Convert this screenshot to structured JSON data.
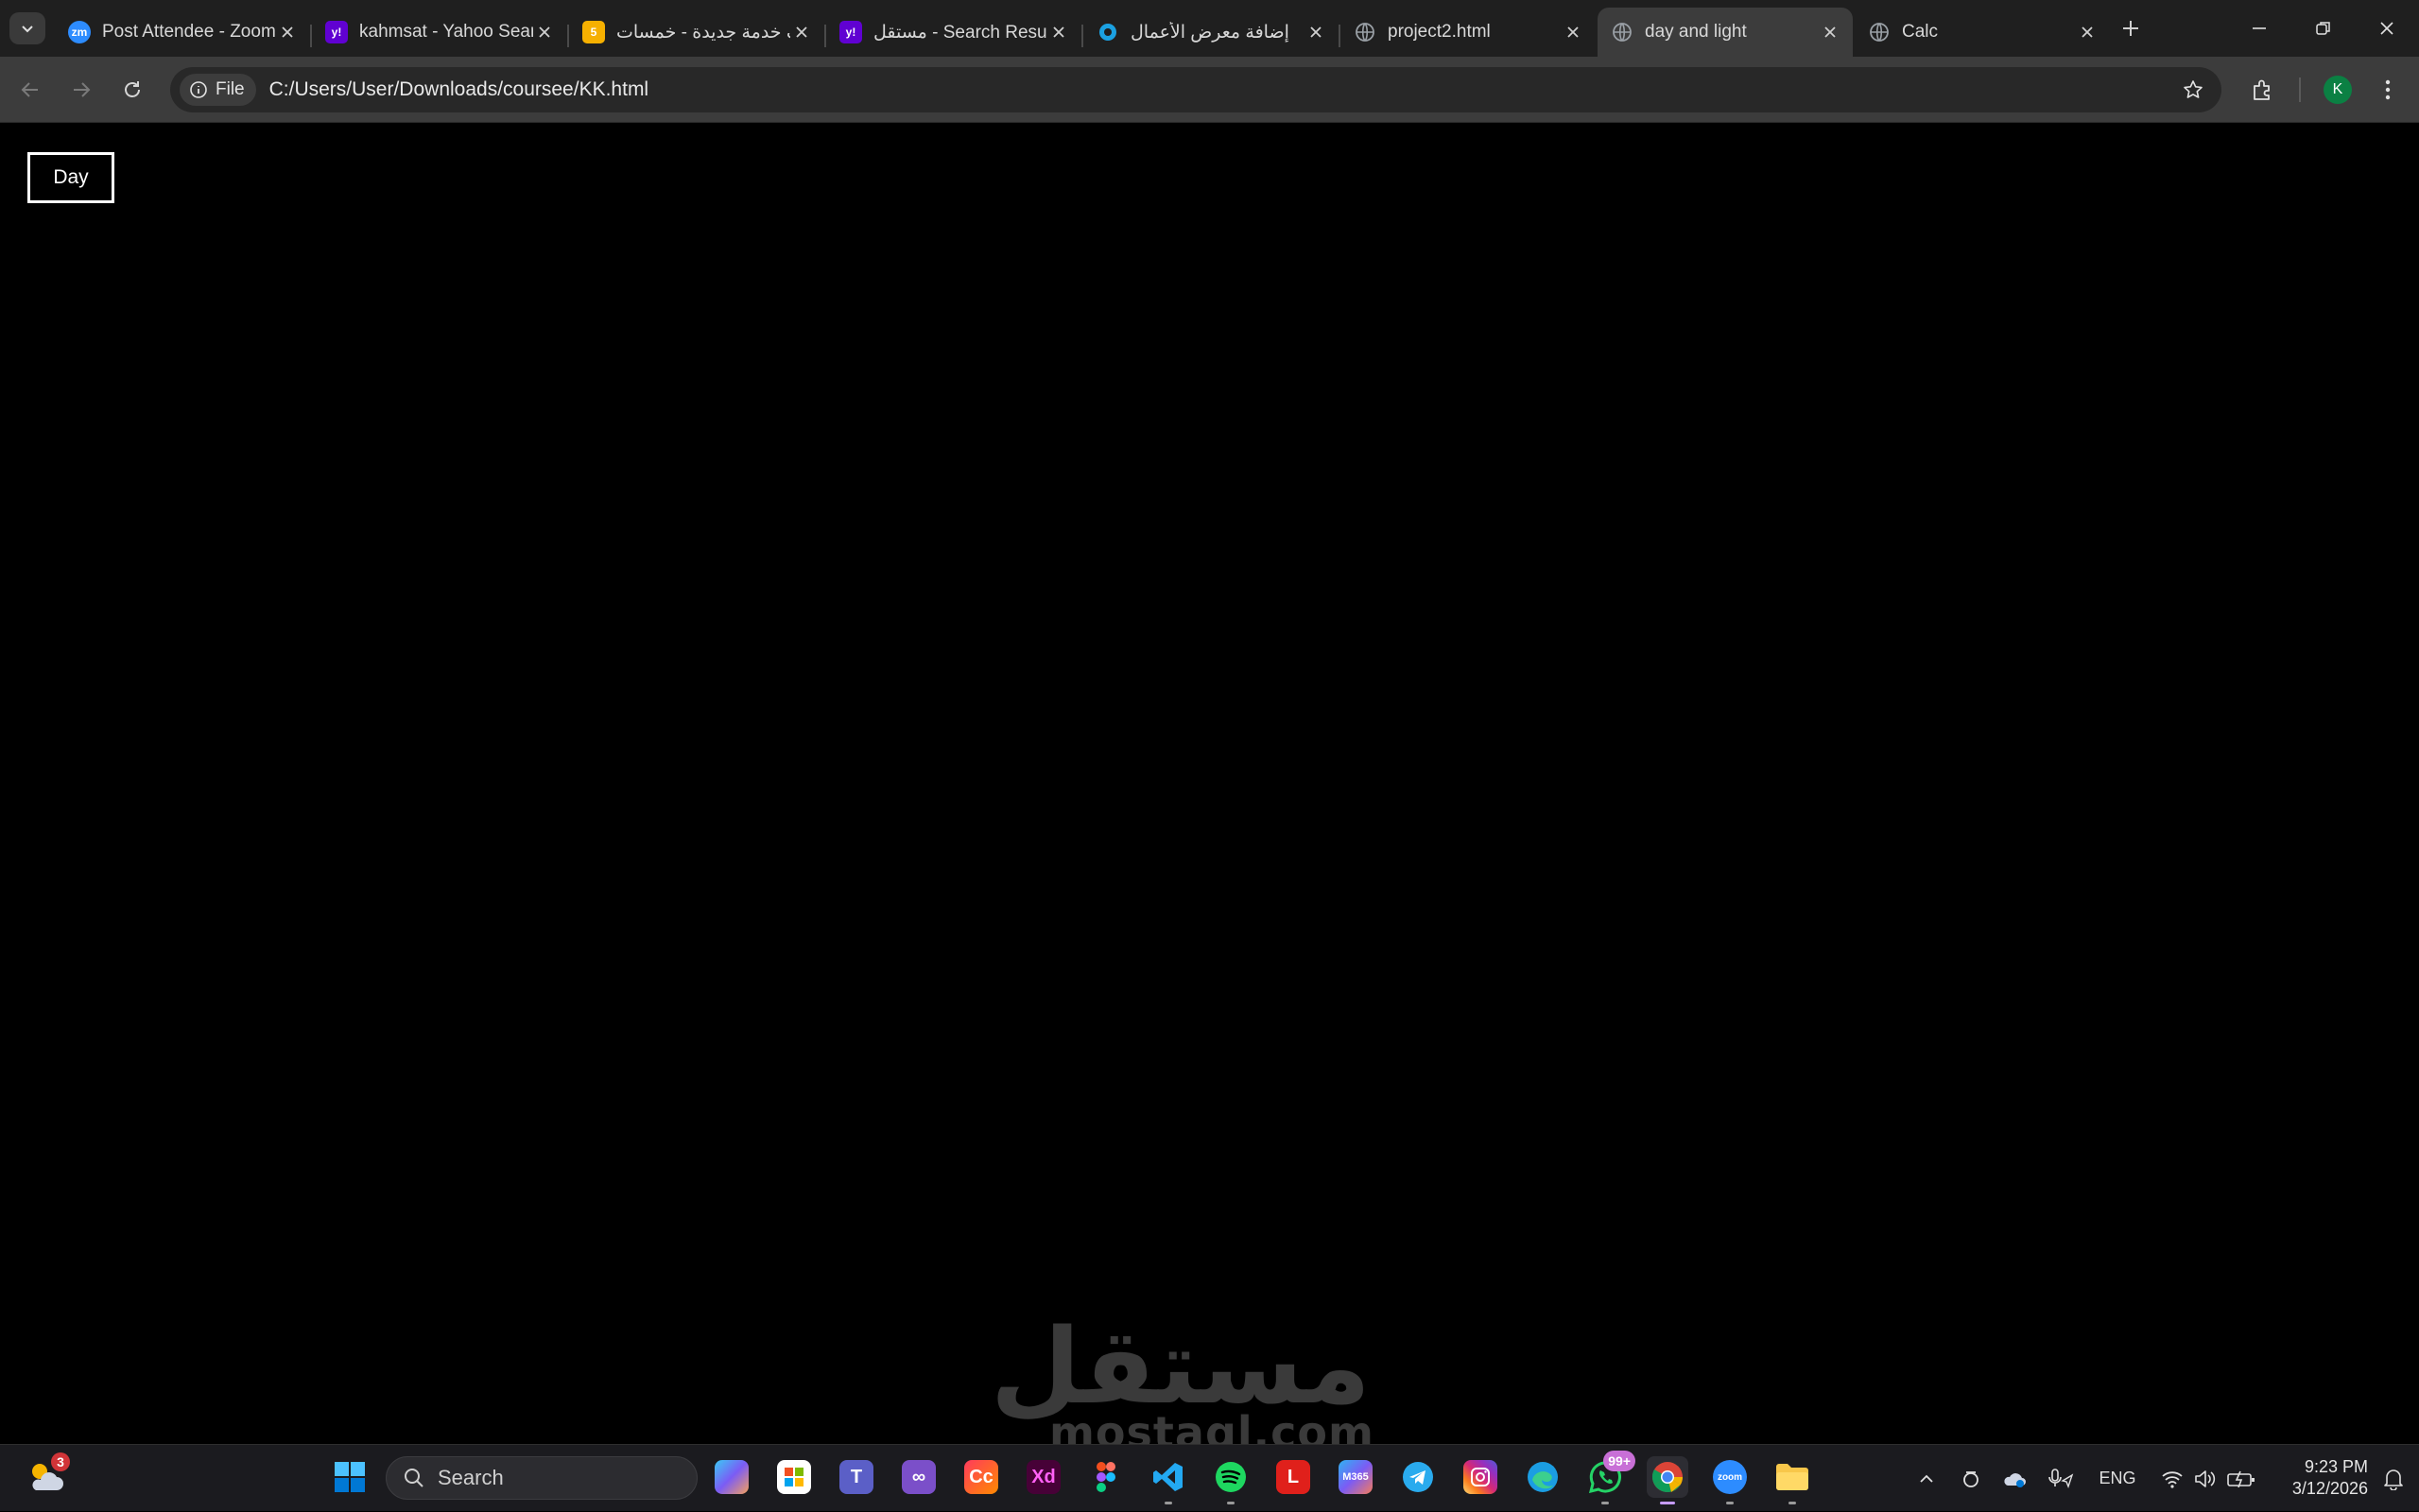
{
  "browser": {
    "tabs": [
      {
        "title": "Post Attendee - Zoom",
        "favicon": "zoom-icon",
        "color": "#2d8cff",
        "favicon_text": "zm"
      },
      {
        "title": "kahmsat - Yahoo Search",
        "favicon": "yahoo-icon",
        "color": "#6001d2",
        "favicon_text": "y!"
      },
      {
        "title": "أضف خدمة جديدة - خمسات",
        "favicon": "khamsat-icon",
        "color": "#f6b000",
        "favicon_text": "5"
      },
      {
        "title": "مستقل - Search Results",
        "favicon": "yahoo-icon",
        "color": "#6001d2",
        "favicon_text": "y!"
      },
      {
        "title": "إضافة معرض الأعمال",
        "favicon": "mostaql-icon",
        "color": "#1ba1e2",
        "favicon_text": ""
      },
      {
        "title": "project2.html",
        "favicon": "globe-icon",
        "color": "#9aa0a6",
        "favicon_text": ""
      },
      {
        "title": "day and light",
        "favicon": "globe-icon",
        "color": "#9aa0a6",
        "favicon_text": ""
      },
      {
        "title": "Calc",
        "favicon": "globe-icon",
        "color": "#9aa0a6",
        "favicon_text": ""
      }
    ],
    "active_tab_index": 6,
    "site_info_label": "File",
    "url": "C:/Users/User/Downloads/coursee/KK.html",
    "profile_initial": "K"
  },
  "page": {
    "toggle_button_label": "Day",
    "background": "#000000",
    "foreground": "#ffffff"
  },
  "watermark": {
    "arabic": "مستقل",
    "latin": "mostaql.com"
  },
  "taskbar": {
    "weather_badge": "3",
    "search_placeholder": "Search",
    "whatsapp_badge": "99+",
    "language": "ENG",
    "time": "9:23 PM",
    "date": "3/12/2026"
  }
}
